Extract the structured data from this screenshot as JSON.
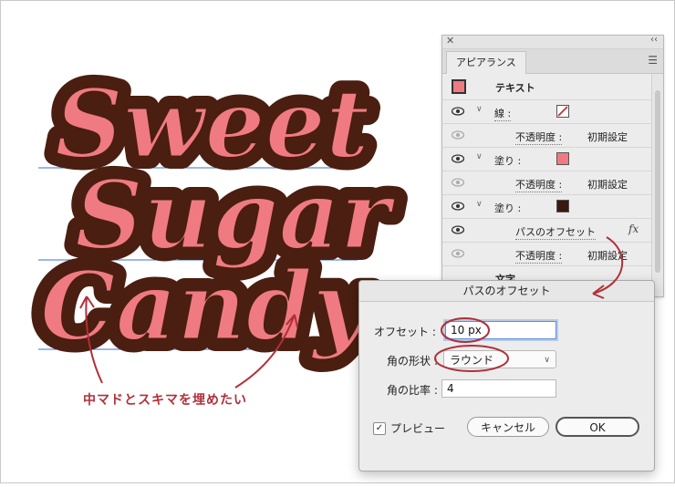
{
  "artwork": {
    "lines": [
      "Sweet",
      "Sugar",
      "Candy"
    ],
    "colors": {
      "fill": "#f07a82",
      "outline": "#4a1e10",
      "guide": "#3b6fd6",
      "annotation": "#b0303a"
    }
  },
  "annotation": {
    "text": "中マドとスキマを埋めたい"
  },
  "appearance_panel": {
    "tab": "アピアランス",
    "rows": [
      {
        "label": "テキスト",
        "type": "header"
      },
      {
        "label": "線 :",
        "type": "stroke"
      },
      {
        "label": "不透明度 :",
        "value": "初期設定",
        "type": "sub"
      },
      {
        "label": "塗り :",
        "type": "fill-pink"
      },
      {
        "label": "不透明度 :",
        "value": "初期設定",
        "type": "sub"
      },
      {
        "label": "塗り :",
        "type": "fill-brown"
      },
      {
        "label": "パスのオフセット",
        "fx": "fx",
        "type": "effect"
      },
      {
        "label": "不透明度 :",
        "value": "初期設定",
        "type": "sub"
      },
      {
        "label": "文字",
        "type": "chars"
      }
    ]
  },
  "offset_dialog": {
    "title": "パスのオフセット",
    "offset_label": "オフセット :",
    "offset_value": "10 px",
    "joins_label": "角の形状 :",
    "joins_value": "ラウンド",
    "miter_label": "角の比率 :",
    "miter_value": "4",
    "preview_label": "プレビュー",
    "preview_checked": true,
    "cancel_label": "キャンセル",
    "ok_label": "OK"
  }
}
